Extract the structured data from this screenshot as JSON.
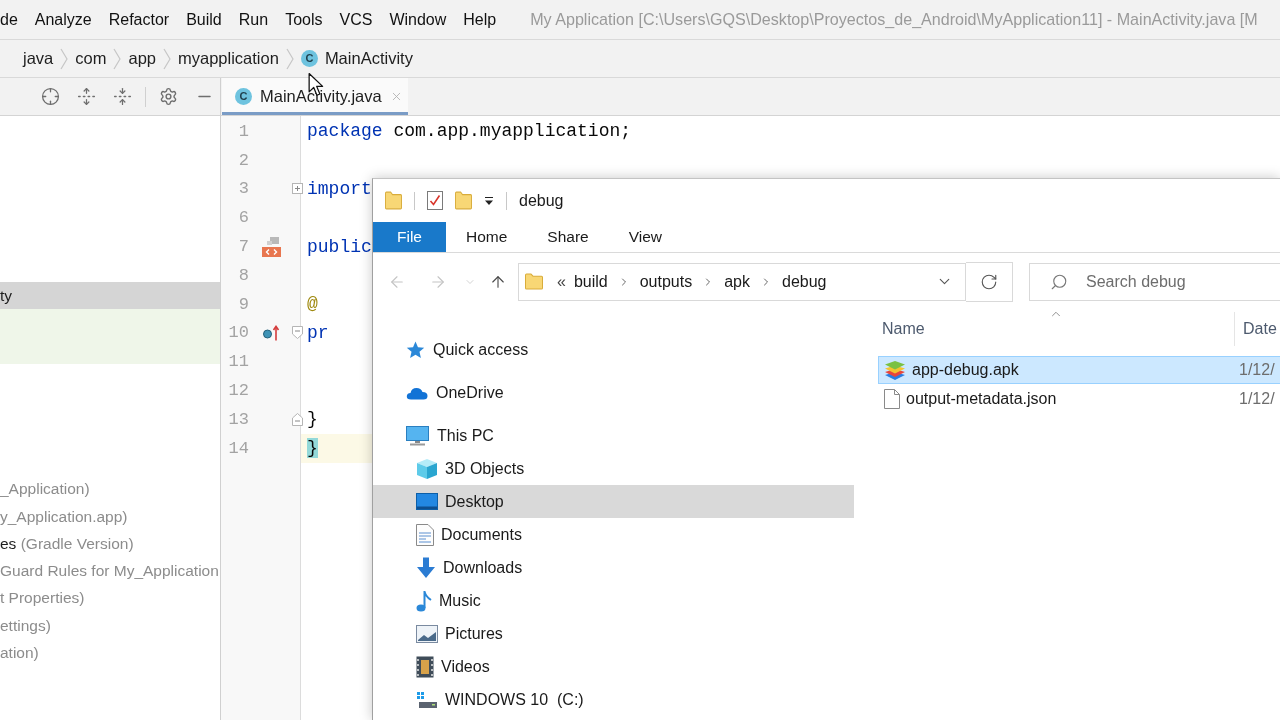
{
  "menu_bar": {
    "items": [
      "de",
      "Analyze",
      "Refactor",
      "Build",
      "Run",
      "Tools",
      "VCS",
      "Window",
      "Help"
    ],
    "title": "My Application [C:\\Users\\GQS\\Desktop\\Proyectos_de_Android\\MyApplication11] - MainActivity.java [M"
  },
  "breadcrumbs": [
    {
      "label": "java"
    },
    {
      "label": "com"
    },
    {
      "label": "app"
    },
    {
      "label": "myapplication"
    },
    {
      "label": "MainActivity",
      "badge": "C"
    }
  ],
  "project_panel": {
    "rows": [
      {
        "name": "ty",
        "selected": true
      },
      {
        "detail": "_Application)",
        "selected": false
      },
      {
        "detail": "y_Application.app)",
        "selected": false
      },
      {
        "name": "es",
        "detail": "(Gradle Version)",
        "selected": false
      },
      {
        "detail": "Guard Rules for My_Application",
        "selected": false
      },
      {
        "detail": "t Properties)",
        "selected": false
      },
      {
        "detail": "ettings)",
        "selected": false
      },
      {
        "detail": "ation)",
        "selected": false
      }
    ]
  },
  "editor": {
    "tabs": [
      {
        "label": "MainActivity.java",
        "badge": "C",
        "selected": true
      }
    ],
    "lines": [
      {
        "number": "1",
        "current": false,
        "tokens": [
          {
            "kind": "keyword",
            "text": "package"
          },
          {
            "kind": "plain",
            "text": " com.app.myapplication;"
          }
        ]
      },
      {
        "number": "2",
        "current": false
      },
      {
        "number": "3",
        "current": false,
        "fold": {
          "kind": "collapsed"
        },
        "tokens": [
          {
            "kind": "keyword",
            "text": "import"
          }
        ]
      },
      {
        "number": "6",
        "current": false
      },
      {
        "number": "7",
        "current": false,
        "marker": {
          "kind": "layout"
        },
        "tokens": [
          {
            "kind": "keyword",
            "text": "public"
          }
        ]
      },
      {
        "number": "8",
        "current": false
      },
      {
        "number": "9",
        "current": false,
        "tokens": [
          {
            "kind": "annotation",
            "text": "    @"
          }
        ]
      },
      {
        "number": "10",
        "current": false,
        "marker": {
          "kind": "override"
        },
        "fold": {
          "kind": "start"
        },
        "tokens": [
          {
            "kind": "keyword",
            "text": "    pr"
          }
        ]
      },
      {
        "number": "11",
        "current": false
      },
      {
        "number": "12",
        "current": false
      },
      {
        "number": "13",
        "current": false,
        "fold": {
          "kind": "end"
        },
        "tokens": [
          {
            "kind": "plain",
            "text": "    }"
          }
        ]
      },
      {
        "number": "14",
        "current": true,
        "tokens": [
          {
            "kind": "brace_match",
            "text": "}"
          }
        ]
      }
    ]
  },
  "explorer": {
    "title": "debug",
    "ribbon_tabs": [
      {
        "label": "File",
        "selected": true
      },
      {
        "label": "Home",
        "selected": false
      },
      {
        "label": "Share",
        "selected": false
      },
      {
        "label": "View",
        "selected": false
      }
    ],
    "nav_buttons": [
      {
        "kind": "back",
        "disabled": true
      },
      {
        "kind": "forward",
        "disabled": true
      },
      {
        "kind": "recent",
        "disabled": true
      },
      {
        "kind": "up",
        "disabled": false
      }
    ],
    "address": {
      "overflow": "«",
      "segments": [
        "build",
        "outputs",
        "apk",
        "debug"
      ]
    },
    "search": {
      "placeholder": "Search debug"
    },
    "nav_pane": [
      {
        "kind": "quick_access",
        "label": "Quick access",
        "selected": false
      },
      {
        "kind": "onedrive",
        "label": "OneDrive",
        "selected": false
      },
      {
        "kind": "this_pc",
        "label": "This PC",
        "selected": false,
        "children": [
          {
            "kind": "objects_3d",
            "label": "3D Objects",
            "selected": false
          },
          {
            "kind": "desktop",
            "label": "Desktop",
            "selected": true
          },
          {
            "kind": "documents",
            "label": "Documents",
            "selected": false
          },
          {
            "kind": "downloads",
            "label": "Downloads",
            "selected": false
          },
          {
            "kind": "music",
            "label": "Music",
            "selected": false
          },
          {
            "kind": "pictures",
            "label": "Pictures",
            "selected": false
          },
          {
            "kind": "videos",
            "label": "Videos",
            "selected": false
          },
          {
            "kind": "drive",
            "label": "WINDOWS 10  (C:)",
            "selected": false
          }
        ]
      }
    ],
    "columns": [
      {
        "label": "Name",
        "sorted": true
      },
      {
        "label": "Date",
        "sorted": false
      }
    ],
    "files": [
      {
        "kind": "apk",
        "name": "app-debug.apk",
        "date": "1/12/",
        "selected": true
      },
      {
        "kind": "json",
        "name": "output-metadata.json",
        "date": "1/12/",
        "selected": false
      }
    ]
  }
}
